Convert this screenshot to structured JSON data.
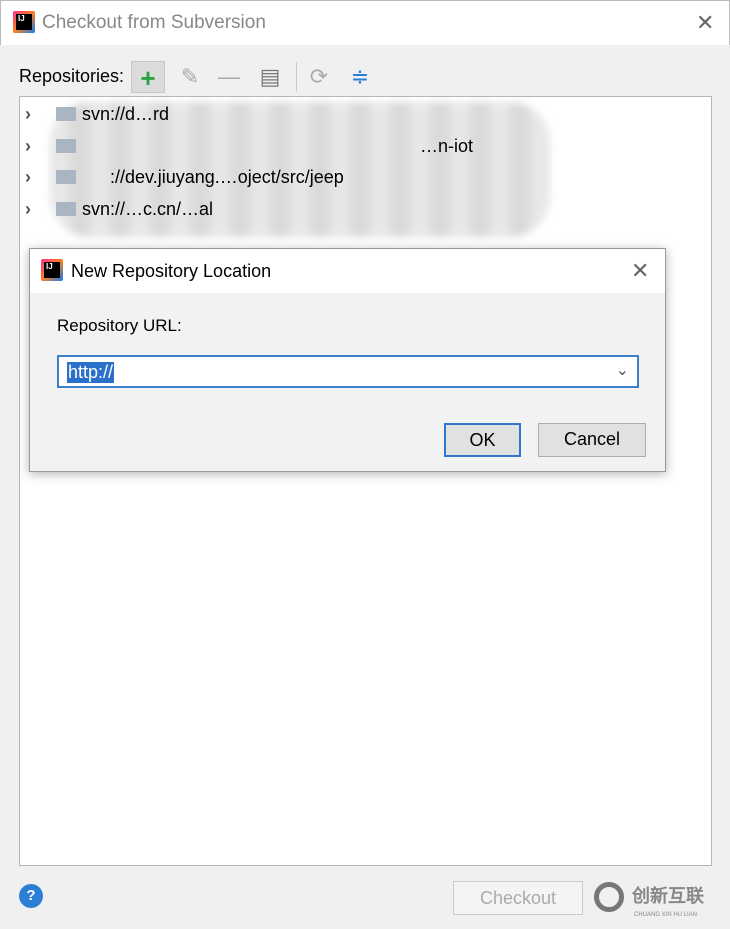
{
  "window": {
    "title": "Checkout from Subversion",
    "checkout_label": "Checkout",
    "help": "?"
  },
  "toolbar": {
    "label": "Repositories:",
    "add": "+",
    "edit": "✎",
    "remove": "—",
    "browse": "▤",
    "refresh": "⟳",
    "collapse": "≑"
  },
  "tree": {
    "items": [
      {
        "text": "svn://d…rd"
      },
      {
        "text": "…n-iot"
      },
      {
        "text": "://dev.jiuyang.…oject/src/jeep"
      },
      {
        "text": "svn://…c.cn/…al"
      }
    ]
  },
  "dialog": {
    "title": "New Repository Location",
    "url_label": "Repository URL:",
    "url_value": "http://",
    "ok": "OK",
    "cancel": "Cancel"
  },
  "watermark": {
    "text": "创新互联",
    "sub": "CHUANG XIN HU LIAN"
  },
  "colors": {
    "accent": "#2a6fc9",
    "add": "#2aa443"
  }
}
